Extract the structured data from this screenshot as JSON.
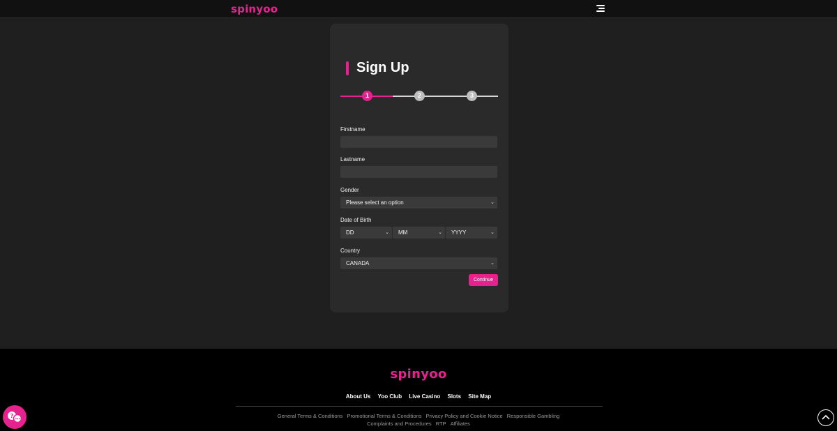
{
  "header": {
    "logo_text": "spinyoo"
  },
  "signup": {
    "title": "Sign Up",
    "steps": [
      "1",
      "2",
      "3"
    ],
    "current_step": 1,
    "fields": {
      "firstname_label": "Firstname",
      "firstname_value": "",
      "lastname_label": "Lastname",
      "lastname_value": "",
      "gender_label": "Gender",
      "gender_value": "Please select an option",
      "dob_label": "Date of Birth",
      "dob_day": "DD",
      "dob_month": "MM",
      "dob_year": "YYYY",
      "country_label": "Country",
      "country_value": "CANADA"
    },
    "continue_label": "Continue"
  },
  "footer": {
    "logo_text": "spinyoo",
    "nav": [
      "About Us",
      "Yoo Club",
      "Live Casino",
      "Slots",
      "Site Map"
    ],
    "legal_row1": [
      "General Terms & Conditions",
      "Promotional Terms & Conditions",
      "Privacy Policy and Cookie Notice",
      "Responsible Gambling"
    ],
    "legal_row2": [
      "Complaints and Procedures",
      "RTP",
      "Affiliates"
    ]
  },
  "colors": {
    "accent": "#e6228f",
    "background": "#1f1f1f",
    "card": "#2a2a2a",
    "input": "#3a3a3a",
    "footer": "#000000"
  },
  "icons": {
    "menu": "hamburger-menu-icon",
    "chevron": "chevron-down-icon",
    "chat": "chat-help-icon",
    "scroll_top": "chevron-up-icon"
  }
}
